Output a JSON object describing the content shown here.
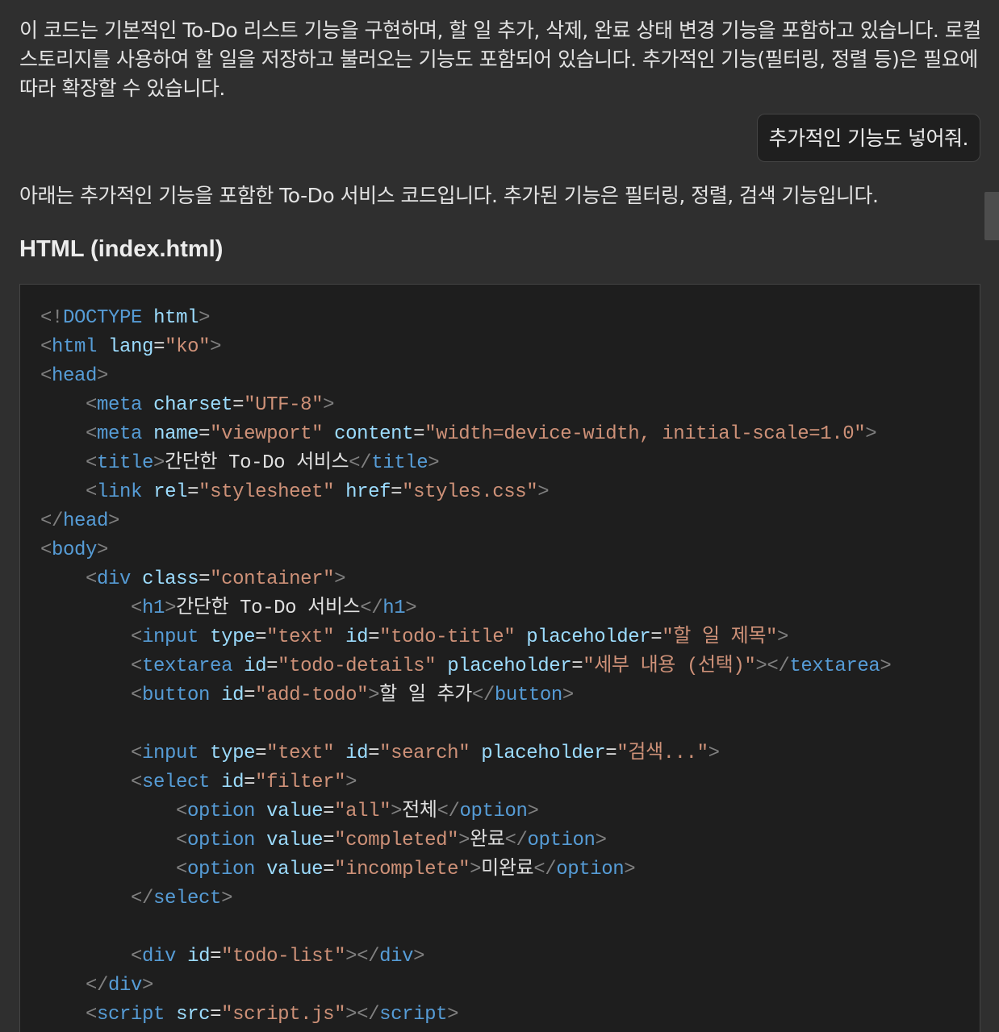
{
  "chat": {
    "intro_text": "이 코드는 기본적인 To-Do 리스트 기능을 구현하며, 할 일 추가, 삭제, 완료 상태 변경 기능을 포함하고 있습니다. 로컬 스토리지를 사용하여 할 일을 저장하고 불러오는 기능도 포함되어 있습니다. 추가적인 기능(필터링, 정렬 등)은 필요에 따라 확장할 수 있습니다.",
    "user_message": "추가적인 기능도 넣어줘.",
    "answer_text": "아래는 추가적인 기능을 포함한 To-Do 서비스 코드입니다. 추가된 기능은 필터링, 정렬, 검색 기능입니다.",
    "section_heading": "HTML (index.html)"
  },
  "code": {
    "language": "html",
    "lines": [
      [
        [
          "p",
          "<!"
        ],
        [
          "t",
          "DOCTYPE"
        ],
        [
          "x",
          " "
        ],
        [
          "a",
          "html"
        ],
        [
          "p",
          ">"
        ]
      ],
      [
        [
          "p",
          "<"
        ],
        [
          "t",
          "html"
        ],
        [
          "x",
          " "
        ],
        [
          "a",
          "lang"
        ],
        [
          "x",
          "="
        ],
        [
          "s",
          "\"ko\""
        ],
        [
          "p",
          ">"
        ]
      ],
      [
        [
          "p",
          "<"
        ],
        [
          "t",
          "head"
        ],
        [
          "p",
          ">"
        ]
      ],
      [
        [
          "x",
          "    "
        ],
        [
          "p",
          "<"
        ],
        [
          "t",
          "meta"
        ],
        [
          "x",
          " "
        ],
        [
          "a",
          "charset"
        ],
        [
          "x",
          "="
        ],
        [
          "s",
          "\"UTF-8\""
        ],
        [
          "p",
          ">"
        ]
      ],
      [
        [
          "x",
          "    "
        ],
        [
          "p",
          "<"
        ],
        [
          "t",
          "meta"
        ],
        [
          "x",
          " "
        ],
        [
          "a",
          "name"
        ],
        [
          "x",
          "="
        ],
        [
          "s",
          "\"viewport\""
        ],
        [
          "x",
          " "
        ],
        [
          "a",
          "content"
        ],
        [
          "x",
          "="
        ],
        [
          "s",
          "\"width=device-width, initial-scale=1.0\""
        ],
        [
          "p",
          ">"
        ]
      ],
      [
        [
          "x",
          "    "
        ],
        [
          "p",
          "<"
        ],
        [
          "t",
          "title"
        ],
        [
          "p",
          ">"
        ],
        [
          "x",
          "간단한 To-Do 서비스"
        ],
        [
          "p",
          "</"
        ],
        [
          "t",
          "title"
        ],
        [
          "p",
          ">"
        ]
      ],
      [
        [
          "x",
          "    "
        ],
        [
          "p",
          "<"
        ],
        [
          "t",
          "link"
        ],
        [
          "x",
          " "
        ],
        [
          "a",
          "rel"
        ],
        [
          "x",
          "="
        ],
        [
          "s",
          "\"stylesheet\""
        ],
        [
          "x",
          " "
        ],
        [
          "a",
          "href"
        ],
        [
          "x",
          "="
        ],
        [
          "s",
          "\"styles.css\""
        ],
        [
          "p",
          ">"
        ]
      ],
      [
        [
          "p",
          "</"
        ],
        [
          "t",
          "head"
        ],
        [
          "p",
          ">"
        ]
      ],
      [
        [
          "p",
          "<"
        ],
        [
          "t",
          "body"
        ],
        [
          "p",
          ">"
        ]
      ],
      [
        [
          "x",
          "    "
        ],
        [
          "p",
          "<"
        ],
        [
          "t",
          "div"
        ],
        [
          "x",
          " "
        ],
        [
          "a",
          "class"
        ],
        [
          "x",
          "="
        ],
        [
          "s",
          "\"container\""
        ],
        [
          "p",
          ">"
        ]
      ],
      [
        [
          "x",
          "        "
        ],
        [
          "p",
          "<"
        ],
        [
          "t",
          "h1"
        ],
        [
          "p",
          ">"
        ],
        [
          "x",
          "간단한 To-Do 서비스"
        ],
        [
          "p",
          "</"
        ],
        [
          "t",
          "h1"
        ],
        [
          "p",
          ">"
        ]
      ],
      [
        [
          "x",
          "        "
        ],
        [
          "p",
          "<"
        ],
        [
          "t",
          "input"
        ],
        [
          "x",
          " "
        ],
        [
          "a",
          "type"
        ],
        [
          "x",
          "="
        ],
        [
          "s",
          "\"text\""
        ],
        [
          "x",
          " "
        ],
        [
          "a",
          "id"
        ],
        [
          "x",
          "="
        ],
        [
          "s",
          "\"todo-title\""
        ],
        [
          "x",
          " "
        ],
        [
          "a",
          "placeholder"
        ],
        [
          "x",
          "="
        ],
        [
          "s",
          "\"할 일 제목\""
        ],
        [
          "p",
          ">"
        ]
      ],
      [
        [
          "x",
          "        "
        ],
        [
          "p",
          "<"
        ],
        [
          "t",
          "textarea"
        ],
        [
          "x",
          " "
        ],
        [
          "a",
          "id"
        ],
        [
          "x",
          "="
        ],
        [
          "s",
          "\"todo-details\""
        ],
        [
          "x",
          " "
        ],
        [
          "a",
          "placeholder"
        ],
        [
          "x",
          "="
        ],
        [
          "s",
          "\"세부 내용 (선택)\""
        ],
        [
          "p",
          "></"
        ],
        [
          "t",
          "textarea"
        ],
        [
          "p",
          ">"
        ]
      ],
      [
        [
          "x",
          "        "
        ],
        [
          "p",
          "<"
        ],
        [
          "t",
          "button"
        ],
        [
          "x",
          " "
        ],
        [
          "a",
          "id"
        ],
        [
          "x",
          "="
        ],
        [
          "s",
          "\"add-todo\""
        ],
        [
          "p",
          ">"
        ],
        [
          "x",
          "할 일 추가"
        ],
        [
          "p",
          "</"
        ],
        [
          "t",
          "button"
        ],
        [
          "p",
          ">"
        ]
      ],
      [],
      [
        [
          "x",
          "        "
        ],
        [
          "p",
          "<"
        ],
        [
          "t",
          "input"
        ],
        [
          "x",
          " "
        ],
        [
          "a",
          "type"
        ],
        [
          "x",
          "="
        ],
        [
          "s",
          "\"text\""
        ],
        [
          "x",
          " "
        ],
        [
          "a",
          "id"
        ],
        [
          "x",
          "="
        ],
        [
          "s",
          "\"search\""
        ],
        [
          "x",
          " "
        ],
        [
          "a",
          "placeholder"
        ],
        [
          "x",
          "="
        ],
        [
          "s",
          "\"검색...\""
        ],
        [
          "p",
          ">"
        ]
      ],
      [
        [
          "x",
          "        "
        ],
        [
          "p",
          "<"
        ],
        [
          "t",
          "select"
        ],
        [
          "x",
          " "
        ],
        [
          "a",
          "id"
        ],
        [
          "x",
          "="
        ],
        [
          "s",
          "\"filter\""
        ],
        [
          "p",
          ">"
        ]
      ],
      [
        [
          "x",
          "            "
        ],
        [
          "p",
          "<"
        ],
        [
          "t",
          "option"
        ],
        [
          "x",
          " "
        ],
        [
          "a",
          "value"
        ],
        [
          "x",
          "="
        ],
        [
          "s",
          "\"all\""
        ],
        [
          "p",
          ">"
        ],
        [
          "x",
          "전체"
        ],
        [
          "p",
          "</"
        ],
        [
          "t",
          "option"
        ],
        [
          "p",
          ">"
        ]
      ],
      [
        [
          "x",
          "            "
        ],
        [
          "p",
          "<"
        ],
        [
          "t",
          "option"
        ],
        [
          "x",
          " "
        ],
        [
          "a",
          "value"
        ],
        [
          "x",
          "="
        ],
        [
          "s",
          "\"completed\""
        ],
        [
          "p",
          ">"
        ],
        [
          "x",
          "완료"
        ],
        [
          "p",
          "</"
        ],
        [
          "t",
          "option"
        ],
        [
          "p",
          ">"
        ]
      ],
      [
        [
          "x",
          "            "
        ],
        [
          "p",
          "<"
        ],
        [
          "t",
          "option"
        ],
        [
          "x",
          " "
        ],
        [
          "a",
          "value"
        ],
        [
          "x",
          "="
        ],
        [
          "s",
          "\"incomplete\""
        ],
        [
          "p",
          ">"
        ],
        [
          "x",
          "미완료"
        ],
        [
          "p",
          "</"
        ],
        [
          "t",
          "option"
        ],
        [
          "p",
          ">"
        ]
      ],
      [
        [
          "x",
          "        "
        ],
        [
          "p",
          "</"
        ],
        [
          "t",
          "select"
        ],
        [
          "p",
          ">"
        ]
      ],
      [],
      [
        [
          "x",
          "        "
        ],
        [
          "p",
          "<"
        ],
        [
          "t",
          "div"
        ],
        [
          "x",
          " "
        ],
        [
          "a",
          "id"
        ],
        [
          "x",
          "="
        ],
        [
          "s",
          "\"todo-list\""
        ],
        [
          "p",
          "></"
        ],
        [
          "t",
          "div"
        ],
        [
          "p",
          ">"
        ]
      ],
      [
        [
          "x",
          "    "
        ],
        [
          "p",
          "</"
        ],
        [
          "t",
          "div"
        ],
        [
          "p",
          ">"
        ]
      ],
      [
        [
          "x",
          "    "
        ],
        [
          "p",
          "<"
        ],
        [
          "t",
          "script"
        ],
        [
          "x",
          " "
        ],
        [
          "a",
          "src"
        ],
        [
          "x",
          "="
        ],
        [
          "s",
          "\"script.js\""
        ],
        [
          "p",
          "></"
        ],
        [
          "t",
          "script"
        ],
        [
          "p",
          ">"
        ]
      ]
    ]
  },
  "colors": {
    "background": "#2f2f2f",
    "code_background": "#1e1e1e",
    "tag": "#569cd6",
    "attribute": "#9cdcfe",
    "string": "#ce9178",
    "punctuation": "#808080",
    "text": "#e0e0e0"
  }
}
